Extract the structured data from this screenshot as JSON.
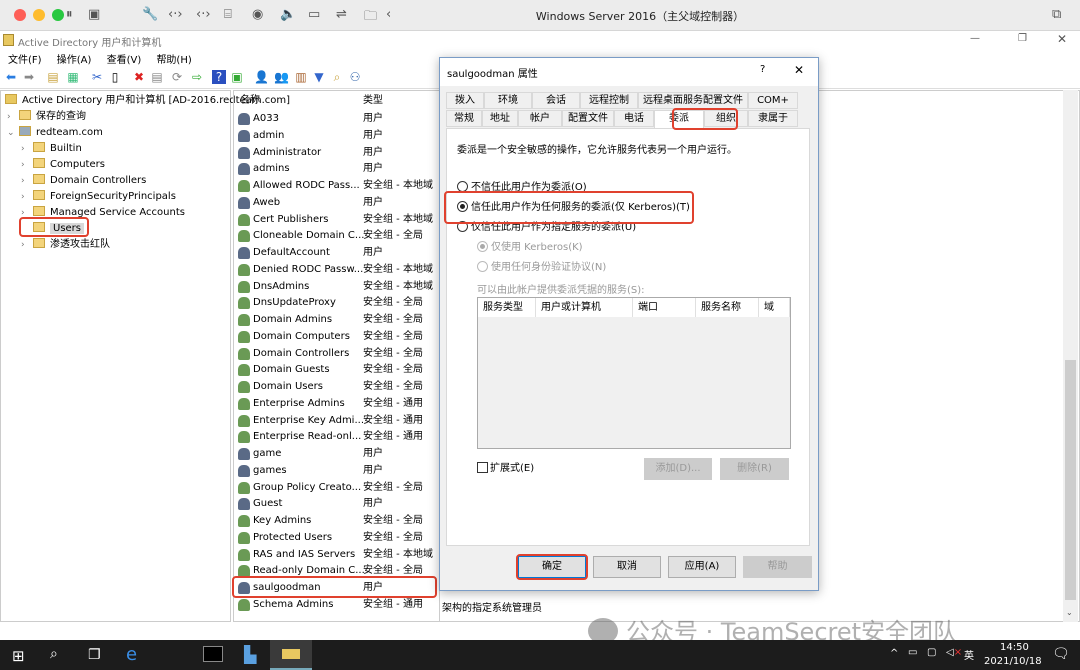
{
  "vm": {
    "title": "Windows Server 2016（主父域控制器）"
  },
  "window": {
    "title": "Active Directory 用户和计算机"
  },
  "menu": [
    "文件(F)",
    "操作(A)",
    "查看(V)",
    "帮助(H)"
  ],
  "tree": {
    "root": "Active Directory 用户和计算机 [AD-2016.redteam.com]",
    "saved": "保存的查询",
    "domain": "redteam.com",
    "children": [
      "Builtin",
      "Computers",
      "Domain Controllers",
      "ForeignSecurityPrincipals",
      "Managed Service Accounts",
      "Users",
      "渗透攻击红队"
    ],
    "selected": "Users"
  },
  "list": {
    "col_name": "名称",
    "col_type": "类型",
    "rows": [
      [
        "A033",
        "用户"
      ],
      [
        "admin",
        "用户"
      ],
      [
        "Administrator",
        "用户"
      ],
      [
        "admins",
        "用户"
      ],
      [
        "Allowed RODC Pass...",
        "安全组 - 本地域"
      ],
      [
        "Aweb",
        "用户"
      ],
      [
        "Cert Publishers",
        "安全组 - 本地域"
      ],
      [
        "Cloneable Domain C...",
        "安全组 - 全局"
      ],
      [
        "DefaultAccount",
        "用户"
      ],
      [
        "Denied RODC Passw...",
        "安全组 - 本地域"
      ],
      [
        "DnsAdmins",
        "安全组 - 本地域"
      ],
      [
        "DnsUpdateProxy",
        "安全组 - 全局"
      ],
      [
        "Domain Admins",
        "安全组 - 全局"
      ],
      [
        "Domain Computers",
        "安全组 - 全局"
      ],
      [
        "Domain Controllers",
        "安全组 - 全局"
      ],
      [
        "Domain Guests",
        "安全组 - 全局"
      ],
      [
        "Domain Users",
        "安全组 - 全局"
      ],
      [
        "Enterprise Admins",
        "安全组 - 通用"
      ],
      [
        "Enterprise Key Admi...",
        "安全组 - 通用"
      ],
      [
        "Enterprise Read-onl...",
        "安全组 - 通用"
      ],
      [
        "game",
        "用户"
      ],
      [
        "games",
        "用户"
      ],
      [
        "Group Policy Creato...",
        "安全组 - 全局"
      ],
      [
        "Guest",
        "用户"
      ],
      [
        "Key Admins",
        "安全组 - 全局"
      ],
      [
        "Protected Users",
        "安全组 - 全局"
      ],
      [
        "RAS and IAS Servers",
        "安全组 - 本地域"
      ],
      [
        "Read-only Domain C...",
        "安全组 - 全局"
      ],
      [
        "saulgoodman",
        "用户"
      ],
      [
        "Schema Admins",
        "安全组 - 通用"
      ]
    ],
    "selected": "saulgoodman",
    "extra_desc": "架构的指定系统管理员"
  },
  "dialog": {
    "title": "saulgoodman 属性",
    "help": "?",
    "close": "✕",
    "tabs_row1": [
      "拨入",
      "环境",
      "会话",
      "远程控制",
      "远程桌面服务配置文件",
      "COM+"
    ],
    "tabs_row2": [
      "常规",
      "地址",
      "帐户",
      "配置文件",
      "电话",
      "委派",
      "组织",
      "隶属于"
    ],
    "active_tab": "委派",
    "description": "委派是一个安全敏感的操作，它允许服务代表另一个用户运行。",
    "options": [
      "不信任此用户作为委派(O)",
      "信任此用户作为任何服务的委派(仅 Kerberos)(T)",
      "仅信任此用户作为指定服务的委派(U)"
    ],
    "selected_option": 1,
    "sub_options": [
      "仅使用 Kerberos(K)",
      "使用任何身份验证协议(N)"
    ],
    "services_label": "可以由此帐户提供委派凭据的服务(S):",
    "columns": [
      "服务类型",
      "用户或计算机",
      "端口",
      "服务名称",
      "域"
    ],
    "expanded": "扩展式(E)",
    "add": "添加(D)...",
    "remove": "删除(R)",
    "ok": "确定",
    "cancel": "取消",
    "apply": "应用(A)",
    "helpbtn": "帮助"
  },
  "taskbar": {
    "time": "14:50",
    "date": "2021/10/18",
    "ime": "英"
  },
  "watermark": "公众号 · TeamSecret安全团队",
  "colors": {
    "highlight": "#e0412e",
    "taskbar": "#1c1c1c"
  }
}
